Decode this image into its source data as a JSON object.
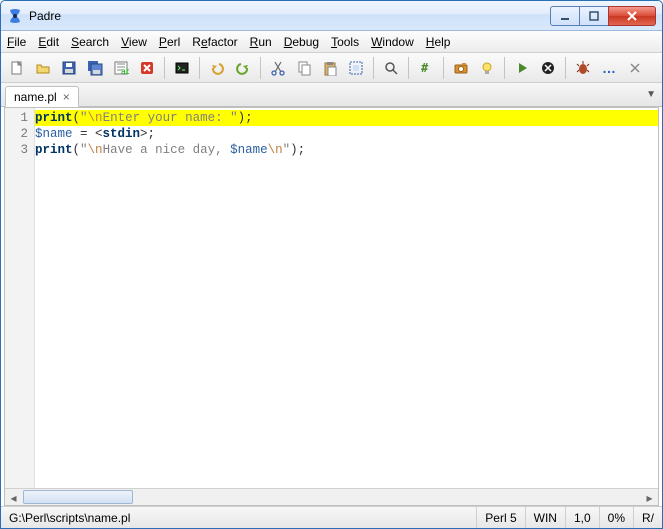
{
  "appTitle": "Padre",
  "menus": [
    "File",
    "Edit",
    "Search",
    "View",
    "Perl",
    "Refactor",
    "Run",
    "Debug",
    "Tools",
    "Window",
    "Help"
  ],
  "tab": {
    "label": "name.pl"
  },
  "code": {
    "lines": [
      {
        "n": 1,
        "segments": [
          {
            "t": "print",
            "c": "kw"
          },
          {
            "t": "(",
            "c": "punct"
          },
          {
            "t": "\"",
            "c": "str"
          },
          {
            "t": "\\n",
            "c": "esc"
          },
          {
            "t": "Enter your name: ",
            "c": "str"
          },
          {
            "t": "\"",
            "c": "str"
          },
          {
            "t": ");",
            "c": "punct"
          }
        ],
        "hl": true
      },
      {
        "n": 2,
        "segments": [
          {
            "t": "$name",
            "c": "var"
          },
          {
            "t": " = <",
            "c": "punct"
          },
          {
            "t": "stdin",
            "c": "kw"
          },
          {
            "t": ">;",
            "c": "punct"
          }
        ]
      },
      {
        "n": 3,
        "segments": [
          {
            "t": "print",
            "c": "kw"
          },
          {
            "t": "(",
            "c": "punct"
          },
          {
            "t": "\"",
            "c": "str"
          },
          {
            "t": "\\n",
            "c": "esc"
          },
          {
            "t": "Have a nice day, ",
            "c": "str"
          },
          {
            "t": "$name",
            "c": "var"
          },
          {
            "t": "\\n",
            "c": "esc"
          },
          {
            "t": "\"",
            "c": "str"
          },
          {
            "t": ");",
            "c": "punct"
          }
        ]
      }
    ]
  },
  "status": {
    "path": "G:\\Perl\\scripts\\name.pl",
    "lang": "Perl 5",
    "os": "WIN",
    "pos": "1,0",
    "pct": "0%",
    "mode": "R/"
  },
  "ellipsis": "…"
}
